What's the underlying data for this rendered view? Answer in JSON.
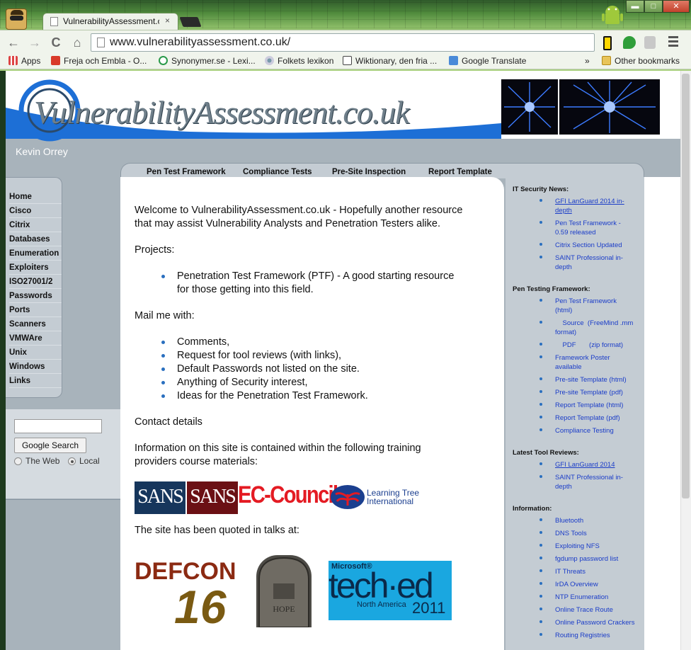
{
  "browser": {
    "tab_title": "VulnerabilityAssessment.c",
    "tab_close": "×",
    "url": "www.vulnerabilityassessment.co.uk/",
    "win_minimize": "▬",
    "win_maximize": "□",
    "win_close": "✕",
    "nav_back": "←",
    "nav_forward": "→",
    "nav_reload": "C",
    "nav_home": "⌂",
    "bookmarks": [
      "Apps",
      "Freja och Embla - O...",
      "Synonymer.se - Lexi...",
      "Folkets lexikon",
      "Wiktionary, den fria ...",
      "Google Translate"
    ],
    "bookmarks_more": "»",
    "other_bookmarks": "Other bookmarks"
  },
  "header": {
    "logo_text": "VulnerabilityAssessment.co.uk",
    "author": "Kevin Orrey"
  },
  "top_tabs": [
    "Pen Test Framework",
    "Compliance Tests",
    "Pre-Site Inspection",
    "Report Template"
  ],
  "left_nav": [
    "Home",
    "Cisco",
    "Citrix",
    "Databases",
    "Enumeration",
    "Exploiters",
    "ISO27001/2",
    "Passwords",
    "Ports",
    "Scanners",
    "VMWAre",
    "Unix",
    "Windows",
    "Links"
  ],
  "search": {
    "input_value": "",
    "button_label": "Google Search",
    "option_web": "The Web",
    "option_local": "Local",
    "selected": "Local"
  },
  "main": {
    "welcome_line1": "Welcome to VulnerabilityAssessment.co.uk -  Hopefully another resource",
    "welcome_line2": "that may assist Vulnerability Analysts and Penetration Testers alike.",
    "projects_heading": "Projects:",
    "project_line1": "Penetration Test Framework (PTF) - A good starting resource",
    "project_line2": "for those getting into this field.",
    "mail_heading": "Mail  me with:",
    "mail_items": [
      "Comments,",
      "Request for tool reviews (with links),",
      "Default Passwords not listed on the site.",
      "Anything of Security interest,",
      "Ideas for the Penetration Test Framework."
    ],
    "contact_heading": "Contact details",
    "info_line1": "Information on this site is contained within the following training",
    "info_line2": "providers course materials:",
    "quoted_line": "The site has been quoted in talks at:",
    "logo_sans": "SANS",
    "logo_ec": "EC-Council",
    "logo_lt_1": "Learning Tree",
    "logo_lt_2": "International",
    "logo_defcon": "DEFCON",
    "logo_defcon_num": "16",
    "logo_hope": "HOPE",
    "logo_ms": "Microsoft®",
    "logo_teched": "tech·ed",
    "logo_na": "North America",
    "logo_year": "2011"
  },
  "sidebar": {
    "news_heading": "IT Security News:",
    "news_items": [
      {
        "line1": "GFI LanGuard 2014 in-",
        "line2": "depth"
      },
      {
        "line1": "Pen Test Framework -",
        "line2": "0.59 released"
      },
      {
        "line1": "Citrix Section Updated",
        "line2": ""
      },
      {
        "line1": "SAINT Professional in-",
        "line2": "depth"
      }
    ],
    "ptf_heading": "Pen Testing Framework:",
    "ptf_items": [
      {
        "line1": "Pen Test Framework",
        "line2": "(html)"
      },
      {
        "line1": "    Source  (FreeMind .mm",
        "line2": "format)"
      },
      {
        "line1": "    PDF       (zip format)",
        "line2": ""
      },
      {
        "line1": "Framework Poster",
        "line2": "available"
      },
      {
        "line1": "Pre-site Template (html)",
        "line2": ""
      },
      {
        "line1": "Pre-site Template (pdf)",
        "line2": ""
      },
      {
        "line1": "Report Template (html)",
        "line2": ""
      },
      {
        "line1": "Report Template (pdf)",
        "line2": ""
      },
      {
        "line1": "Compliance Testing",
        "line2": ""
      }
    ],
    "reviews_heading": "Latest Tool Reviews:",
    "reviews_items": [
      {
        "line1": "GFI LanGuard 2014",
        "line2": ""
      },
      {
        "line1": "SAINT Professional in-",
        "line2": "depth"
      }
    ],
    "info_heading": "Information:",
    "info_items": [
      "Bluetooth",
      "DNS Tools",
      "Exploiting NFS",
      "fgdump password list",
      "IT Threats",
      "IrDA Overview",
      "NTP Enumeration",
      "Online Trace Route",
      "Online Password Crackers",
      "Routing Registries"
    ]
  },
  "colors": {
    "chrome_green": "#8fc06a",
    "site_gray": "#a8b3bb",
    "panel_gray": "#c4ccd3",
    "link_blue": "#1a3cc8",
    "brand_blue": "#1d6fd6"
  }
}
